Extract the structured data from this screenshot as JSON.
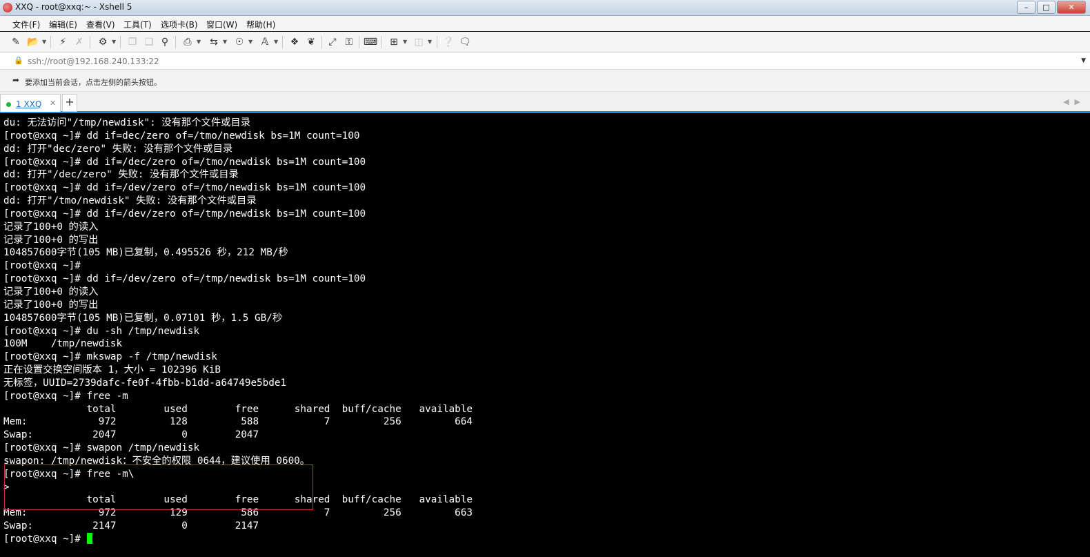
{
  "window": {
    "title": "XXQ - root@xxq:~ - Xshell 5",
    "controls": [
      "–",
      "□",
      "✕"
    ]
  },
  "menubar": {
    "items": [
      "文件(F)",
      "编辑(E)",
      "查看(V)",
      "工具(T)",
      "选项卡(B)",
      "窗口(W)",
      "帮助(H)"
    ]
  },
  "toolbar": {
    "icons": [
      "new-session-icon",
      "open-folder-icon",
      "connect-icon",
      "disconnect-icon",
      "settings-icon",
      "copy-icon",
      "paste-icon",
      "find-icon",
      "print-icon",
      "transfer-icon",
      "globe-icon",
      "font-icon",
      "xftp-icon",
      "xmanager-icon",
      "fullscreen-icon",
      "lock-icon",
      "keyboard-icon",
      "add-tab-icon",
      "layout-icon",
      "help-icon",
      "chat-icon"
    ]
  },
  "address": {
    "value": "ssh://root@192.168.240.133:22"
  },
  "hint": {
    "text": "要添加当前会话，点击左侧的箭头按钮。"
  },
  "tabs": [
    {
      "label": "1 XXQ",
      "status_color": "#1fb33b"
    }
  ],
  "new_tab_label": "+",
  "terminal": {
    "lines": [
      "du: 无法访问\"/tmp/newdisk\": 没有那个文件或目录",
      "[root@xxq ~]# dd if=dec/zero of=/tmo/newdisk bs=1M count=100",
      "dd: 打开\"dec/zero\" 失败: 没有那个文件或目录",
      "[root@xxq ~]# dd if=/dec/zero of=/tmo/newdisk bs=1M count=100",
      "dd: 打开\"/dec/zero\" 失败: 没有那个文件或目录",
      "[root@xxq ~]# dd if=/dev/zero of=/tmo/newdisk bs=1M count=100",
      "dd: 打开\"/tmo/newdisk\" 失败: 没有那个文件或目录",
      "[root@xxq ~]# dd if=/dev/zero of=/tmp/newdisk bs=1M count=100",
      "记录了100+0 的读入",
      "记录了100+0 的写出",
      "104857600字节(105 MB)已复制，0.495526 秒，212 MB/秒",
      "[root@xxq ~]#",
      "[root@xxq ~]# dd if=/dev/zero of=/tmp/newdisk bs=1M count=100",
      "记录了100+0 的读入",
      "记录了100+0 的写出",
      "104857600字节(105 MB)已复制，0.07101 秒，1.5 GB/秒",
      "[root@xxq ~]# du -sh /tmp/newdisk",
      "100M    /tmp/newdisk",
      "[root@xxq ~]# mkswap -f /tmp/newdisk",
      "正在设置交换空间版本 1，大小 = 102396 KiB",
      "无标签，UUID=2739dafc-fe0f-4fbb-b1dd-a64749e5bde1",
      "[root@xxq ~]# free -m",
      "              total        used        free      shared  buff/cache   available",
      "Mem:            972         128         588           7         256         664",
      "Swap:          2047           0        2047",
      "[root@xxq ~]# swapon /tmp/newdisk",
      "swapon: /tmp/newdisk：不安全的权限 0644，建议使用 0600。",
      "[root@xxq ~]# free -m\\",
      ">",
      "              total        used        free      shared  buff/cache   available",
      "Mem:            972         129         586           7         256         663",
      "Swap:          2147           0        2147",
      "[root@xxq ~]# "
    ],
    "cursor_color": "#00ff00",
    "highlight_color": "#d42b2b"
  }
}
